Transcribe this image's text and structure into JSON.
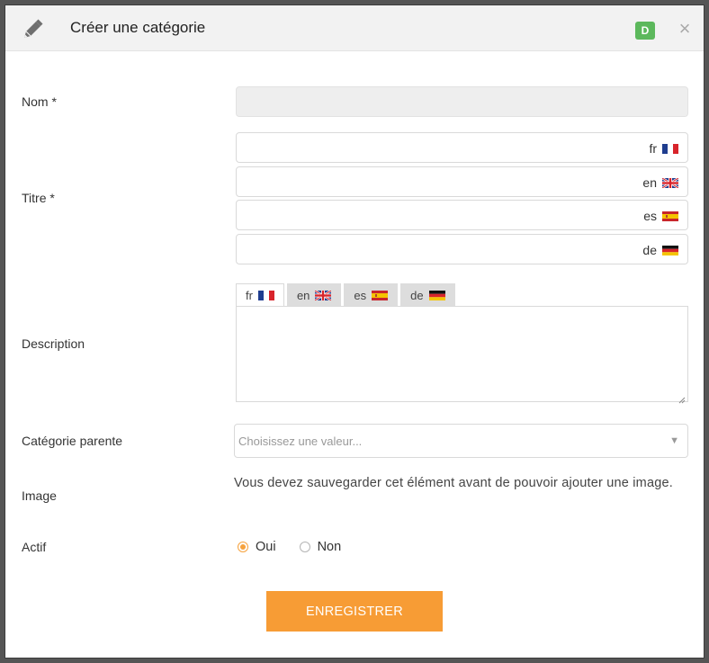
{
  "dialog": {
    "title": "Créer une catégorie",
    "badge": "D",
    "close_symbol": "×"
  },
  "form": {
    "nom": {
      "label": "Nom *",
      "value": ""
    },
    "titre": {
      "label": "Titre *",
      "langs": [
        {
          "code": "fr",
          "value": "",
          "flag": "fr-flag-icon"
        },
        {
          "code": "en",
          "value": "",
          "flag": "uk-flag-icon"
        },
        {
          "code": "es",
          "value": "",
          "flag": "es-flag-icon"
        },
        {
          "code": "de",
          "value": "",
          "flag": "de-flag-icon"
        }
      ]
    },
    "description": {
      "label": "Description",
      "tabs": [
        {
          "code": "fr",
          "active": true
        },
        {
          "code": "en",
          "active": false
        },
        {
          "code": "es",
          "active": false
        },
        {
          "code": "de",
          "active": false
        }
      ],
      "value": ""
    },
    "parent": {
      "label": "Catégorie parente",
      "placeholder": "Choisissez une valeur...",
      "arrow": "▼"
    },
    "image": {
      "label": "Image",
      "note": "Vous devez sauvegarder cet élément avant de pouvoir ajouter une image."
    },
    "actif": {
      "label": "Actif",
      "options": [
        "Oui",
        "Non"
      ],
      "selected": "Oui"
    },
    "save_label": "ENREGISTRER"
  },
  "colors": {
    "accent": "#f79c35",
    "badge": "#5cb85c"
  }
}
